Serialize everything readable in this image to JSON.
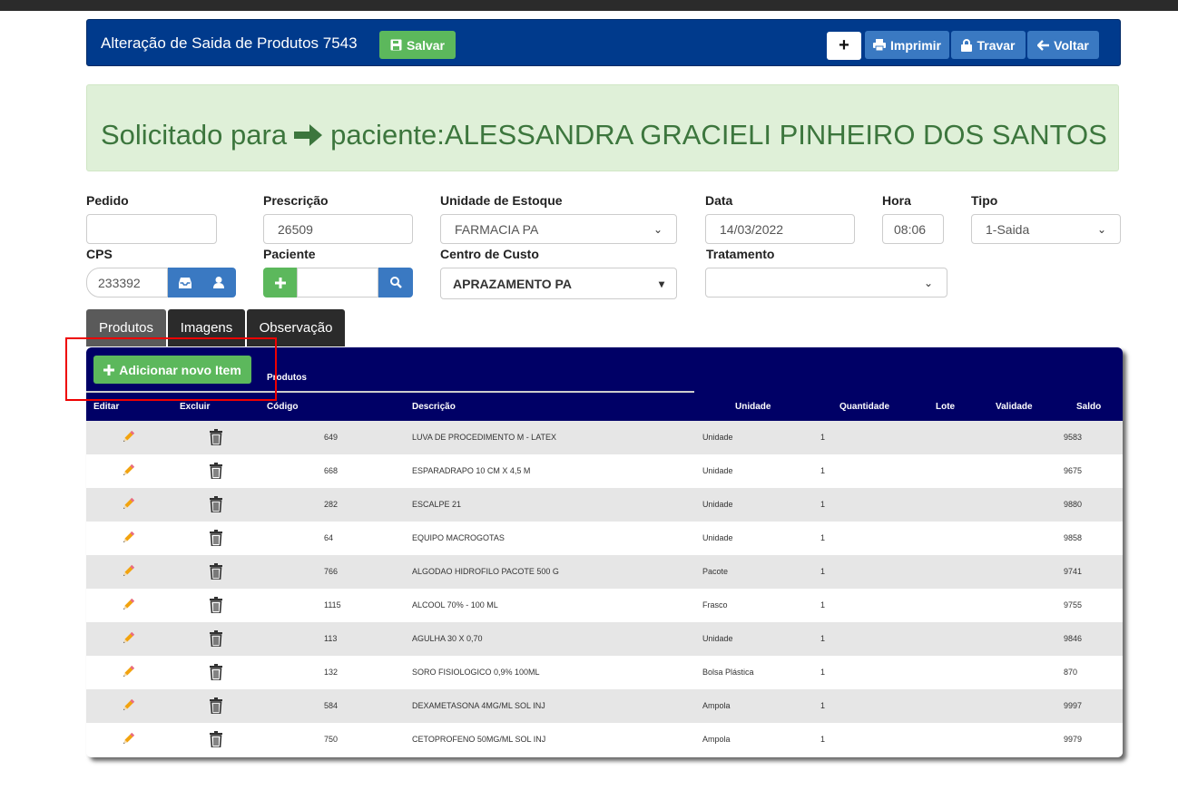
{
  "header": {
    "title": "Alteração de Saida de Produtos 7543",
    "save_label": "Salvar",
    "add_label": "+",
    "print_label": "Imprimir",
    "lock_label": "Travar",
    "back_label": "Voltar"
  },
  "alert": {
    "prefix": "Solicitado para",
    "text": "paciente:ALESSANDRA GRACIELI PINHEIRO DOS SANTOS"
  },
  "form": {
    "pedido": {
      "label": "Pedido",
      "value": ""
    },
    "prescricao": {
      "label": "Prescrição",
      "value": "26509"
    },
    "unidade_estoque": {
      "label": "Unidade de Estoque",
      "value": "FARMACIA PA"
    },
    "data": {
      "label": "Data",
      "value": "14/03/2022"
    },
    "hora": {
      "label": "Hora",
      "value": "08:06"
    },
    "tipo": {
      "label": "Tipo",
      "value": "1-Saida"
    },
    "cps": {
      "label": "CPS",
      "value": "233392"
    },
    "paciente": {
      "label": "Paciente",
      "value": ""
    },
    "centro_custo": {
      "label": "Centro de Custo",
      "value": "APRAZAMENTO PA"
    },
    "tratamento": {
      "label": "Tratamento",
      "value": ""
    }
  },
  "tabs": [
    "Produtos",
    "Imagens",
    "Observação"
  ],
  "table": {
    "add_label": "Adicionar novo Item",
    "section_label": "Produtos",
    "columns": [
      "Editar",
      "Excluir",
      "Código",
      "Descrição",
      "Unidade",
      "Quantidade",
      "Lote",
      "Validade",
      "Saldo"
    ],
    "rows": [
      [
        "649",
        "LUVA DE PROCEDIMENTO M - LATEX",
        "Unidade",
        "1",
        "9583"
      ],
      [
        "668",
        "ESPARADRAPO 10 CM X 4,5 M",
        "Unidade",
        "1",
        "9675"
      ],
      [
        "282",
        "ESCALPE 21",
        "Unidade",
        "1",
        "9880"
      ],
      [
        "64",
        "EQUIPO MACROGOTAS",
        "Unidade",
        "1",
        "9858"
      ],
      [
        "766",
        "ALGODAO HIDROFILO PACOTE 500 G",
        "Pacote",
        "1",
        "9741"
      ],
      [
        "1115",
        "ALCOOL 70% - 100 ML",
        "Frasco",
        "1",
        "9755"
      ],
      [
        "113",
        "AGULHA 30 X 0,70",
        "Unidade",
        "1",
        "9846"
      ],
      [
        "132",
        "SORO FISIOLOGICO 0,9% 100ML",
        "Bolsa Plástica",
        "1",
        "870"
      ],
      [
        "584",
        "DEXAMETASONA 4MG/ML SOL INJ",
        "Ampola",
        "1",
        "9997"
      ],
      [
        "750",
        "CETOPROFENO 50MG/ML SOL INJ",
        "Ampola",
        "1",
        "9979"
      ]
    ]
  }
}
